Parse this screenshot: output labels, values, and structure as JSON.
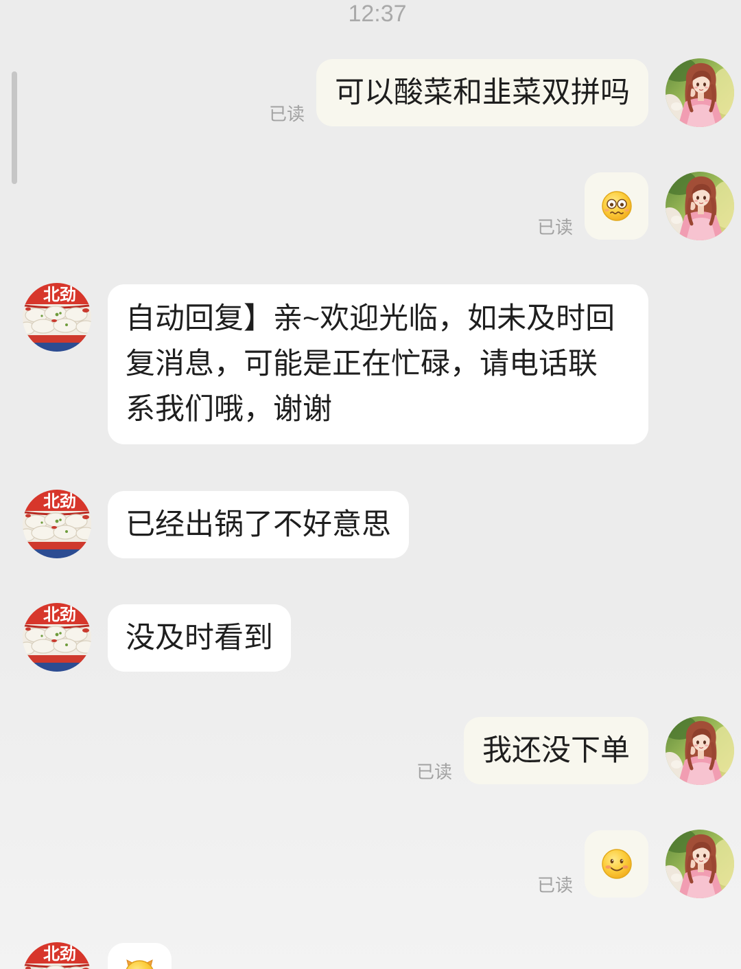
{
  "timestamp": "12:37",
  "shop_avatar_logo_text": "北劲",
  "messages": [
    {
      "text": "可以酸菜和韭菜双拼吗",
      "read_status": "已读",
      "avatar_icon": "girl-avatar"
    },
    {
      "emoji_icon": "worried-face-emoji",
      "read_status": "已读",
      "avatar_icon": "girl-avatar"
    },
    {
      "text_lines": [
        "自动回复】亲~欢迎光临，如未及时回",
        "复消息，可能是正在忙碌，请电话联",
        "系我们哦，谢谢"
      ],
      "avatar_icon": "dumpling-shop-avatar"
    },
    {
      "text": "已经出锅了不好意思",
      "avatar_icon": "dumpling-shop-avatar"
    },
    {
      "text": "没及时看到",
      "avatar_icon": "dumpling-shop-avatar"
    },
    {
      "text": "我还没下单",
      "read_status": "已读",
      "avatar_icon": "girl-avatar"
    },
    {
      "emoji_icon": "smiling-face-emoji",
      "read_status": "已读",
      "avatar_icon": "girl-avatar"
    },
    {
      "emoji_icon": "partial-emoji",
      "avatar_icon": "dumpling-shop-avatar"
    }
  ],
  "colors": {
    "background_top": "#ececec",
    "background_bottom": "#f3f3f3",
    "outgoing_bubble": "#f8f7ee",
    "incoming_bubble": "#ffffff",
    "message_text": "#1e1e1e",
    "read_status_text": "#a2a2a2",
    "timestamp_text": "#a9a9a9",
    "scrollbar": "#c6c6c6"
  }
}
